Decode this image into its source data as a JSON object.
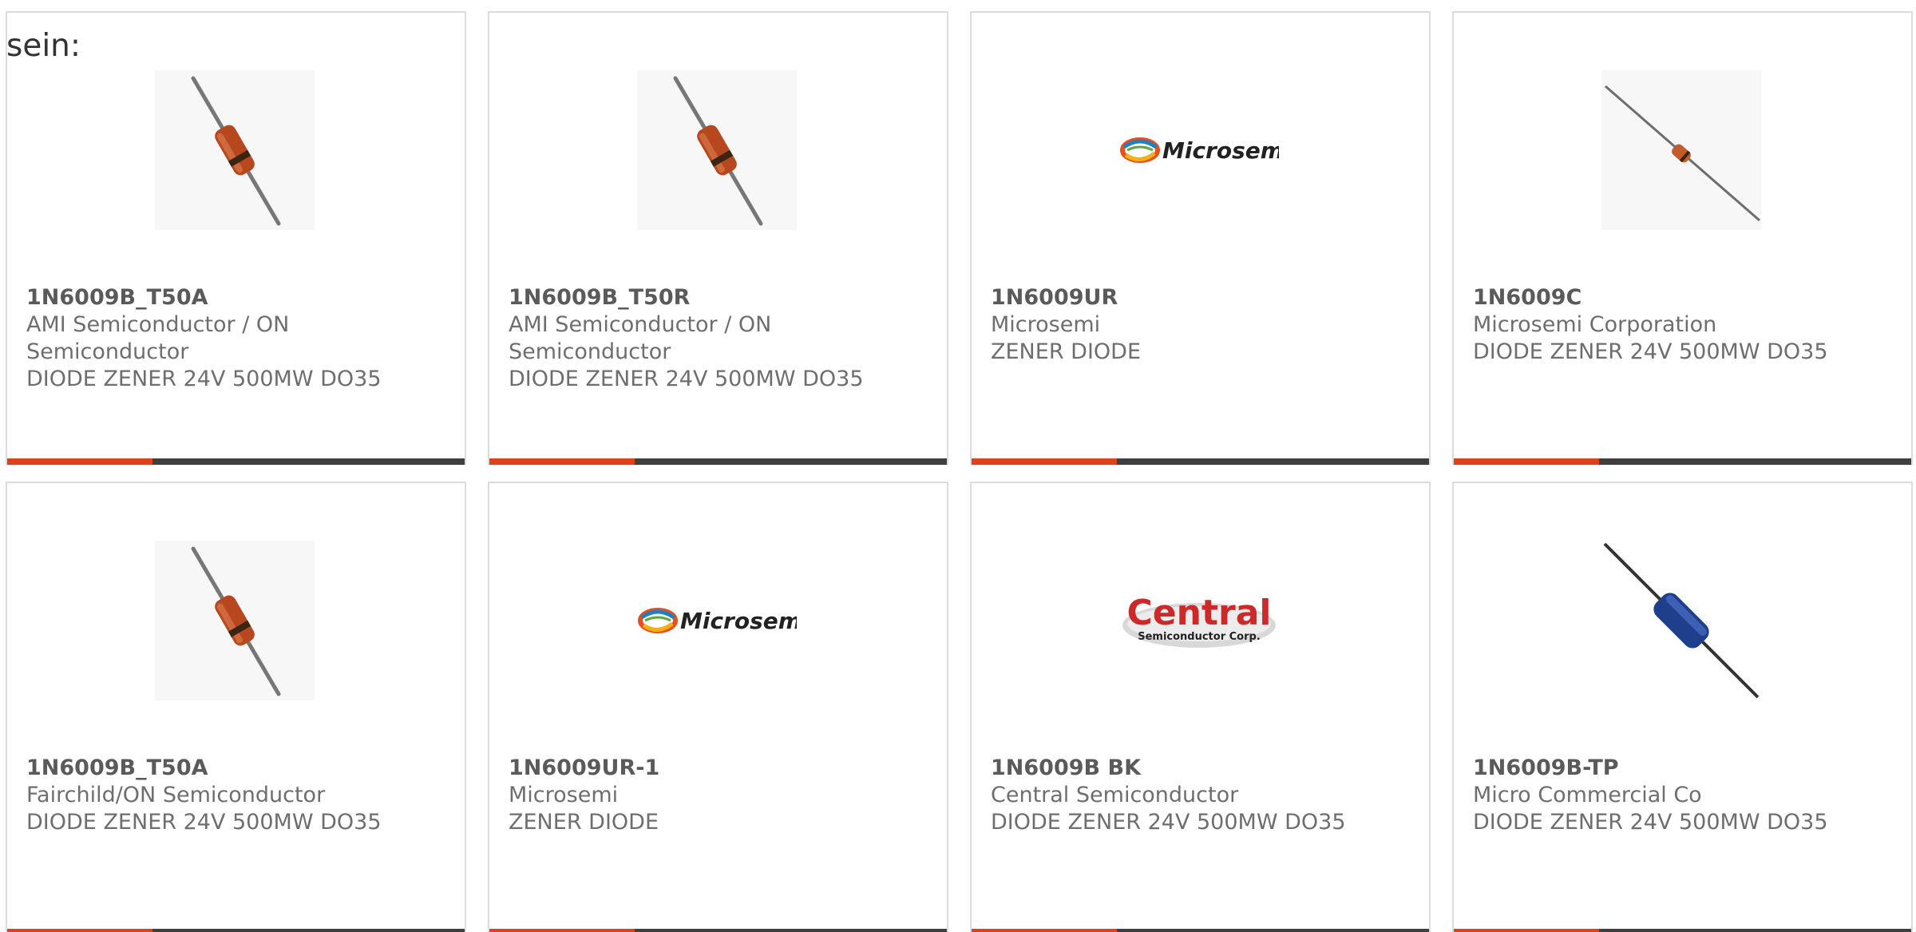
{
  "intro_text": "sein:",
  "cards": [
    {
      "part": "1N6009B_T50A",
      "maker_lines": [
        "AMI Semiconductor / ON",
        "Semiconductor"
      ],
      "desc": "DIODE ZENER 24V 500MW DO35",
      "image": "orange-glass-diode-diagonal-icon"
    },
    {
      "part": "1N6009B_T50R",
      "maker_lines": [
        "AMI Semiconductor / ON",
        "Semiconductor"
      ],
      "desc": "DIODE ZENER 24V 500MW DO35",
      "image": "orange-glass-diode-diagonal-icon"
    },
    {
      "part": "1N6009UR",
      "maker_lines": [
        "Microsemi"
      ],
      "desc": "ZENER DIODE",
      "image": "microsemi-logo",
      "logo_text": "Microsemi"
    },
    {
      "part": "1N6009C",
      "maker_lines": [
        "Microsemi Corporation"
      ],
      "desc": "DIODE ZENER 24V 500MW DO35",
      "image": "small-axial-diode-icon"
    },
    {
      "part": "1N6009B_T50A",
      "maker_lines": [
        "Fairchild/ON Semiconductor"
      ],
      "desc": "DIODE ZENER 24V 500MW DO35",
      "image": "orange-glass-diode-diagonal-icon"
    },
    {
      "part": "1N6009UR-1",
      "maker_lines": [
        "Microsemi"
      ],
      "desc": "ZENER DIODE",
      "image": "microsemi-logo",
      "logo_text": "Microsemi"
    },
    {
      "part": "1N6009B BK",
      "maker_lines": [
        "Central Semiconductor"
      ],
      "desc": "DIODE ZENER 24V 500MW DO35",
      "image": "central-semiconductor-logo",
      "logo_text": "Central",
      "logo_subtext": "Semiconductor Corp."
    },
    {
      "part": "1N6009B-TP",
      "maker_lines": [
        "Micro Commercial Co"
      ],
      "desc": "DIODE ZENER 24V 500MW DO35",
      "image": "blue-axial-diode-icon"
    }
  ],
  "colors": {
    "accent": "#e0401a",
    "bar": "#3f3f3f",
    "border": "#dcdcdc",
    "text": "#6e6e6e"
  }
}
